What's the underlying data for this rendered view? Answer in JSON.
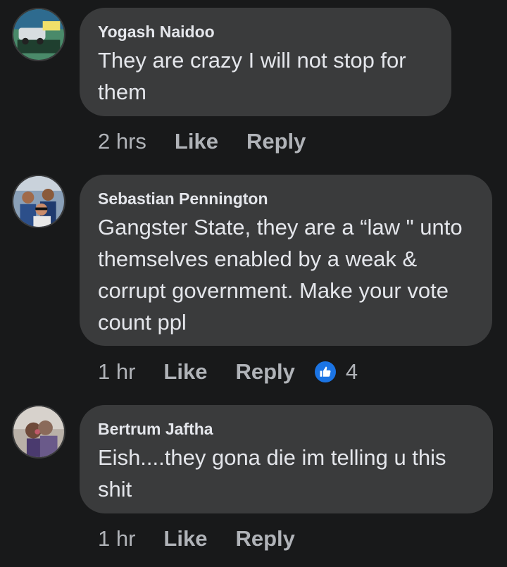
{
  "comments": [
    {
      "author": "Yogash Naidoo",
      "text": "They are crazy I will not stop for them",
      "time": "2 hrs",
      "like_label": "Like",
      "reply_label": "Reply"
    },
    {
      "author": "Sebastian Pennington",
      "text": "Gangster State, they are a “law \" unto themselves enabled by a weak & corrupt government. Make your vote count ppl",
      "time": "1 hr",
      "like_label": "Like",
      "reply_label": "Reply",
      "reaction_count": "4",
      "reaction_icon": "thumbs-up-icon"
    },
    {
      "author": "Bertrum Jaftha",
      "text": "Eish....they gona die im telling u this shit",
      "time": "1 hr",
      "like_label": "Like",
      "reply_label": "Reply"
    }
  ],
  "colors": {
    "background": "#18191a",
    "bubble": "#3a3b3c",
    "text": "#e4e6eb",
    "secondary": "#b0b3b8",
    "like_blue": "#1b74e4"
  }
}
